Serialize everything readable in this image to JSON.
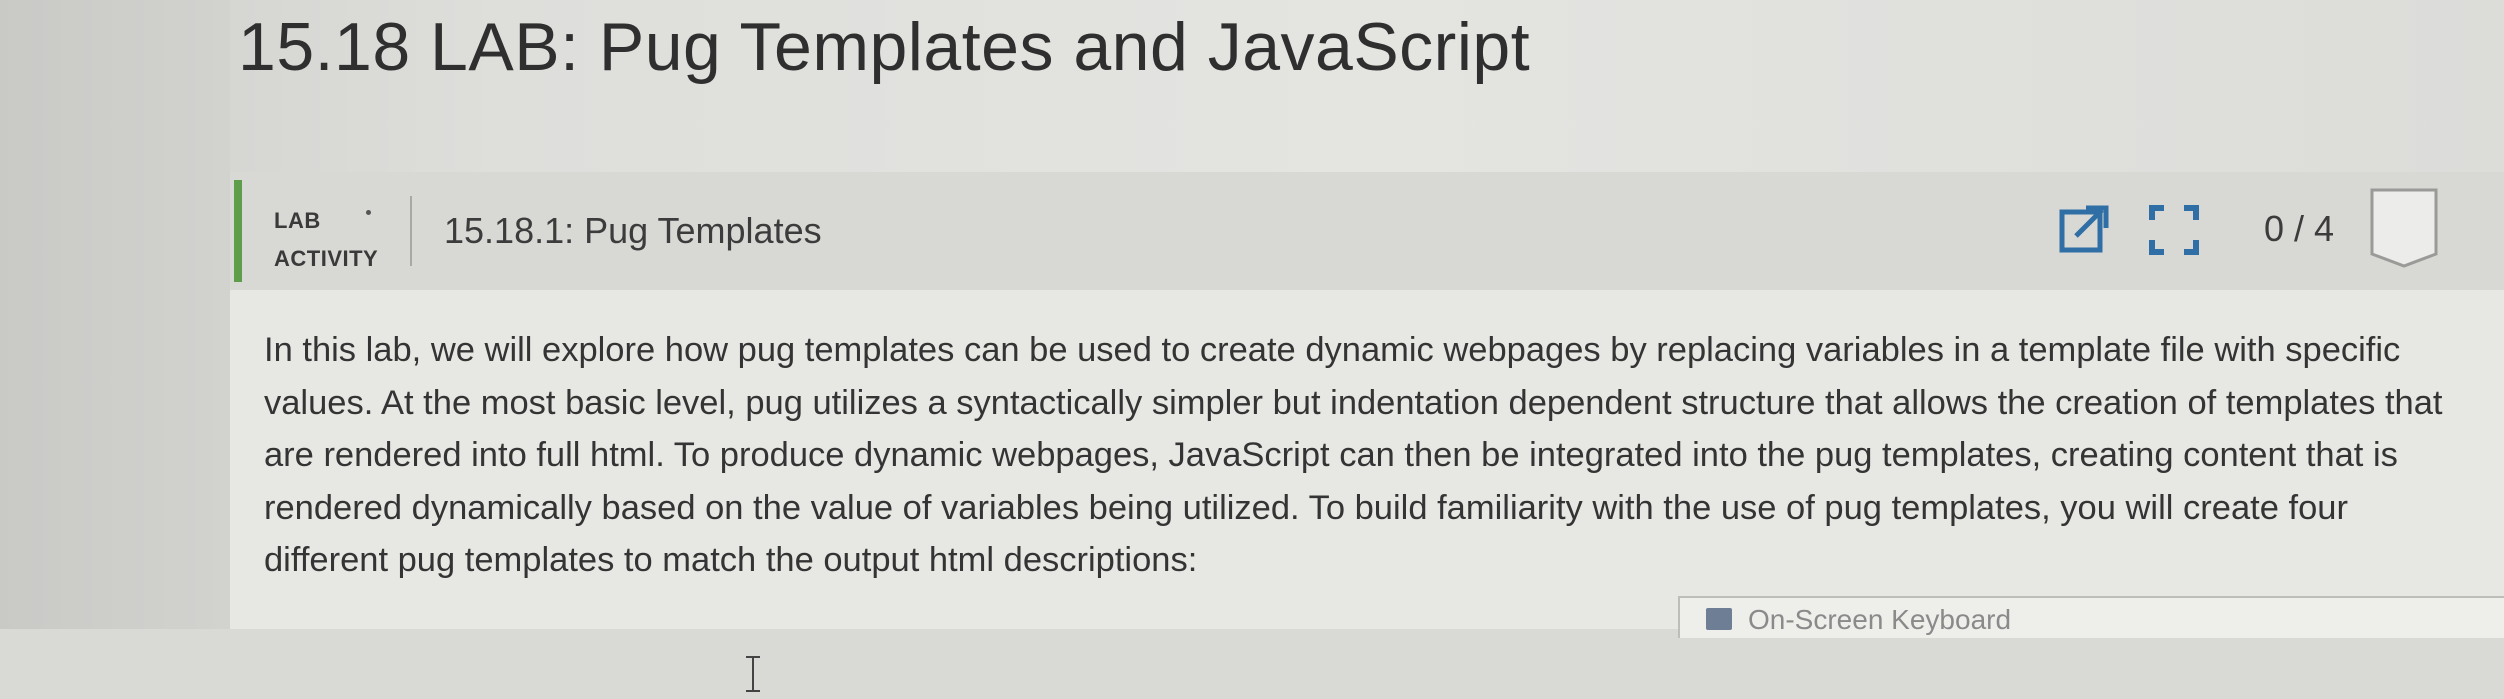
{
  "page": {
    "title": "15.18 LAB: Pug Templates and JavaScript"
  },
  "activity": {
    "type_label": "LAB\nACTIVITY",
    "title": "15.18.1: Pug Templates",
    "score": "0 / 4",
    "icons": [
      "open-in-new-window-icon",
      "fullscreen-icon"
    ],
    "accent_color": "#5e9e4b",
    "icon_color": "#2f6fa6"
  },
  "instructions": {
    "text": "In this lab, we will explore how pug templates can be used to create dynamic webpages by replacing variables in a template file with specific values. At the most basic level, pug utilizes a syntactically simpler but indentation dependent structure that allows the creation of templates that are rendered into full html. To produce dynamic webpages, JavaScript can then be integrated into the pug templates, creating content that is rendered dynamically based on the value of variables being utilized. To build familiarity with the use of pug templates, you will create four different pug templates to match the output html descriptions:"
  },
  "on_screen_keyboard": {
    "label": "On-Screen Keyboard"
  }
}
